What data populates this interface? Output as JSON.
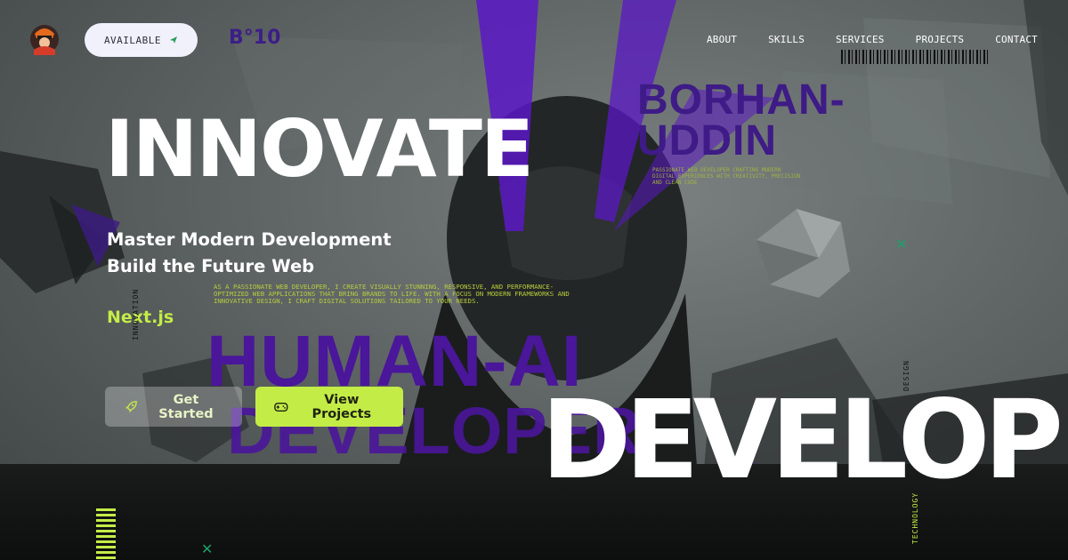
{
  "header": {
    "status_label": "AVAILABLE",
    "brand_mark": "B°10",
    "nav": [
      "ABOUT",
      "SKILLS",
      "SERVICES",
      "PROJECTS",
      "CONTACT"
    ]
  },
  "hero": {
    "headline": "INNOVATE",
    "subtitle_line1": "Master Modern Development",
    "subtitle_line2": "Build the Future Web",
    "tech": "Next.js",
    "intro": "AS A PASSIONATE WEB DEVELOPER, I CREATE VISUALLY STUNNING, RESPONSIVE, AND PERFORMANCE-OPTIMIZED WEB APPLICATIONS THAT BRING BRANDS TO LIFE. WITH A FOCUS ON MODERN FRAMEWORKS AND INNOVATIVE DESIGN, I CRAFT DIGITAL SOLUTIONS TAILORED TO YOUR NEEDS.",
    "name_line1": "BORHAN-",
    "name_line2": "UDDIN",
    "name_note": "PASSIONATE WEB DEVELOPER CRAFTING MODERN DIGITAL EXPERIENCES WITH CREATIVITY, PRECISION AND CLEAN CODE",
    "human_ai": "HUMAN-AI",
    "develo": "DEVELOPER",
    "big_develop": "DEVELOP",
    "side_innovation": "INNOVATION",
    "side_design": "DESIGN",
    "side_technology": "TECHNOLOGY"
  },
  "buttons": {
    "get_started": "Get Started",
    "view_projects": "View Projects"
  },
  "colors": {
    "accent": "#c4ec47",
    "purple": "#4a169a",
    "teal": "#1aa06a"
  }
}
